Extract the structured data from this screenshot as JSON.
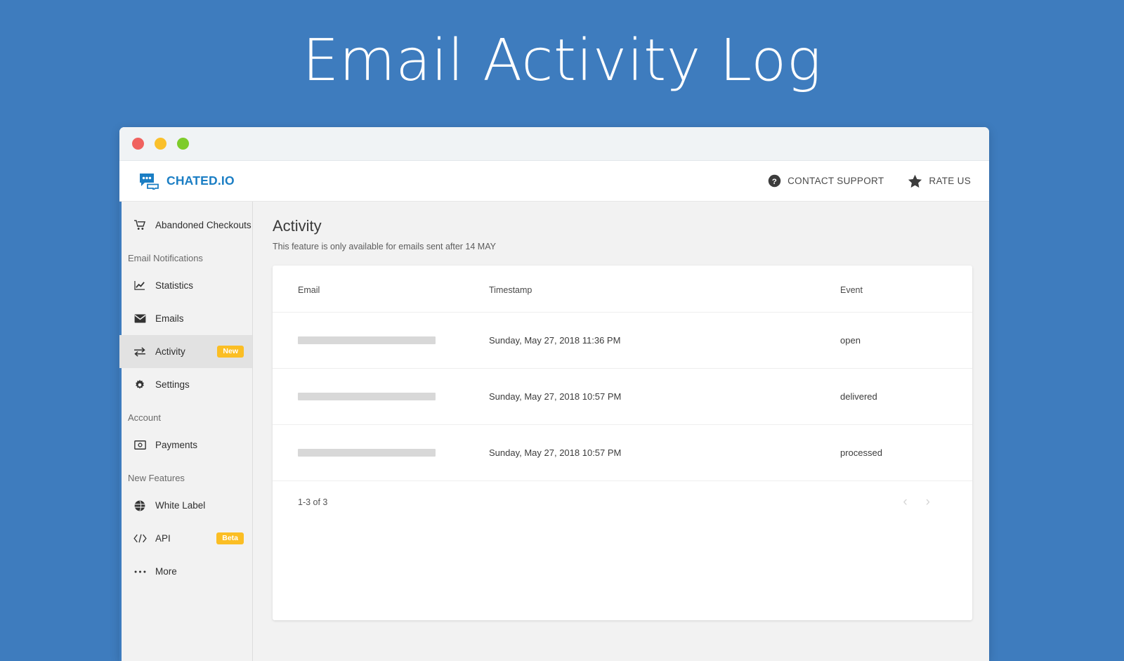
{
  "hero": {
    "title": "Email Activity Log",
    "background_color": "#3e7cbe"
  },
  "window": {
    "traffic_lights": [
      {
        "name": "close",
        "color": "#f0625f"
      },
      {
        "name": "minimize",
        "color": "#fac02b"
      },
      {
        "name": "maximize",
        "color": "#7ecc2b"
      }
    ]
  },
  "header": {
    "brand": "CHATED.IO",
    "brand_color": "#1b7ec4",
    "logo_icon": "chat-bubble-icon",
    "actions": [
      {
        "label": "CONTACT SUPPORT",
        "icon": "question-mark-circle-icon"
      },
      {
        "label": "RATE US",
        "icon": "star-icon"
      }
    ]
  },
  "sidebar": {
    "items": [
      {
        "label": "Abandoned Checkouts",
        "icon": "shopping-cart-icon",
        "badge": null,
        "active": false
      },
      {
        "label": "Statistics",
        "icon": "line-chart-icon",
        "badge": null,
        "active": false
      },
      {
        "label": "Emails",
        "icon": "envelope-icon",
        "badge": null,
        "active": false
      },
      {
        "label": "Activity",
        "icon": "transfer-arrows-icon",
        "badge": "New",
        "active": true
      },
      {
        "label": "Settings",
        "icon": "gear-icon",
        "badge": null,
        "active": false
      },
      {
        "label": "Payments",
        "icon": "banknote-icon",
        "badge": null,
        "active": false
      },
      {
        "label": "White Label",
        "icon": "globe-icon",
        "badge": null,
        "active": false
      },
      {
        "label": "API",
        "icon": "code-brackets-icon",
        "badge": "Beta",
        "active": false
      },
      {
        "label": "More",
        "icon": "ellipsis-icon",
        "badge": null,
        "active": false
      }
    ],
    "sections": {
      "email_notifications": "Email Notifications",
      "account": "Account",
      "new_features": "New Features"
    },
    "badge_color": "#fbbe24"
  },
  "main": {
    "title": "Activity",
    "subtitle": "This feature is only available for emails sent after 14 MAY",
    "table": {
      "columns": [
        "Email",
        "Timestamp",
        "Event"
      ],
      "rows": [
        {
          "email": "",
          "email_redacted": true,
          "timestamp": "Sunday, May 27, 2018 11:36 PM",
          "event": "open"
        },
        {
          "email": "",
          "email_redacted": true,
          "timestamp": "Sunday, May 27, 2018 10:57 PM",
          "event": "delivered"
        },
        {
          "email": "",
          "email_redacted": true,
          "timestamp": "Sunday, May 27, 2018 10:57 PM",
          "event": "processed"
        }
      ]
    },
    "pagination": {
      "count_label": "1-3 of 3",
      "prev_icon": "chevron-left-icon",
      "next_icon": "chevron-right-icon",
      "prev_glyph": "‹",
      "next_glyph": "›"
    }
  }
}
